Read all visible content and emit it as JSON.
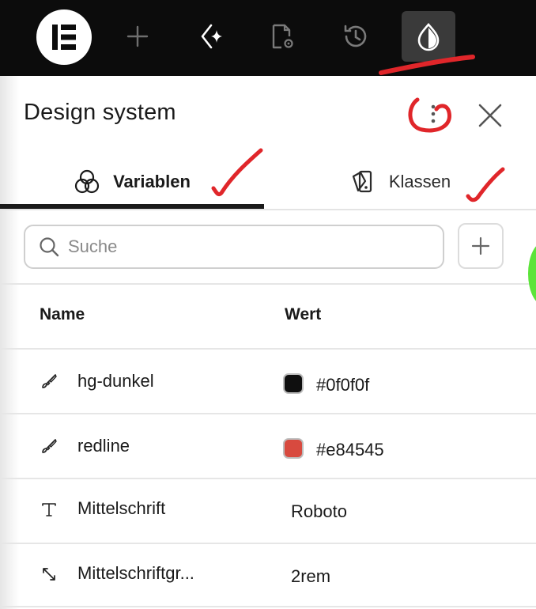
{
  "toolbar": {
    "buttons": [
      {
        "icon": "elementor-logo-icon"
      },
      {
        "icon": "plus-icon"
      },
      {
        "icon": "sparkle-icon"
      },
      {
        "icon": "page-settings-icon"
      },
      {
        "icon": "history-icon"
      },
      {
        "icon": "drop-icon",
        "active": true
      }
    ]
  },
  "panel": {
    "title": "Design system",
    "tabs": {
      "variables": "Variablen",
      "classes": "Klassen"
    },
    "search": {
      "placeholder": "Suche",
      "value": ""
    },
    "table": {
      "headers": {
        "name": "Name",
        "value": "Wert"
      },
      "rows": [
        {
          "icon": "brush-icon",
          "name": "hg-dunkel",
          "value": "#0f0f0f",
          "swatch": "#0f0f0f"
        },
        {
          "icon": "brush-icon",
          "name": "redline",
          "value": "#e84545",
          "swatch": "#d84a3f"
        },
        {
          "icon": "text-type-icon",
          "name": "Mittelschrift",
          "value": "Roboto"
        },
        {
          "icon": "resize-arrow-icon",
          "name": "Mittelschriftgr...",
          "value": "2rem"
        }
      ]
    }
  },
  "colors": {
    "toolbar_bg": "#0c0c0c",
    "active_button": "#3a3a3a",
    "annotation_red": "#e0262a",
    "green_accent": "#5ce43a"
  }
}
